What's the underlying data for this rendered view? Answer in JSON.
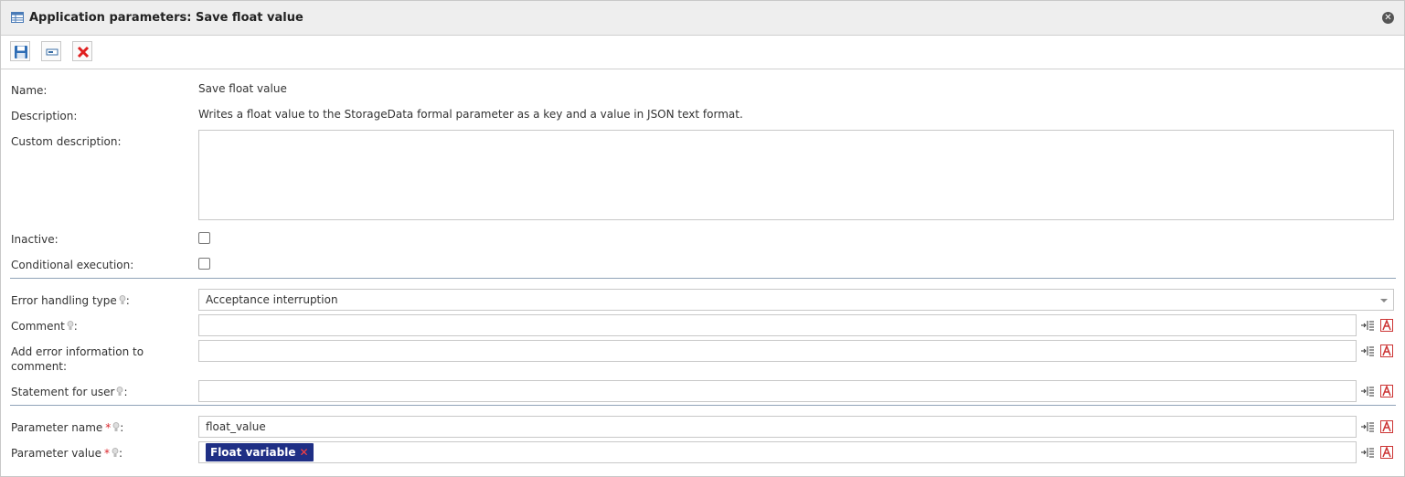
{
  "window": {
    "title": "Application parameters: Save float value"
  },
  "toolbar": {
    "buttons": [
      {
        "name": "save",
        "icon": "floppy-disk-icon"
      },
      {
        "name": "show",
        "icon": "window-icon"
      },
      {
        "name": "cancel",
        "icon": "red-x-icon"
      }
    ]
  },
  "form": {
    "name_label": "Name:",
    "name_value": "Save float value",
    "description_label": "Description:",
    "description_value": "Writes a float value to the StorageData formal parameter as a key and a value in JSON text format.",
    "custom_description_label": "Custom description:",
    "custom_description_value": "",
    "inactive_label": "Inactive:",
    "inactive_checked": false,
    "conditional_label": "Conditional execution:",
    "conditional_checked": false,
    "error_handling_label": "Error handling type",
    "error_handling_value": "Acceptance interruption",
    "comment_label": "Comment",
    "comment_value": "",
    "add_error_label": "Add error information to comment:",
    "add_error_value": "",
    "statement_label": "Statement for user",
    "statement_value": "",
    "param_name_label": "Parameter name",
    "param_name_value": "float_value",
    "param_value_label": "Parameter value",
    "param_value_tag": "Float variable",
    "required_mark": "*",
    "colon": ":"
  },
  "colors": {
    "accent": "#1f2f85",
    "required": "#d9262c",
    "divider": "#8fa3b8"
  }
}
